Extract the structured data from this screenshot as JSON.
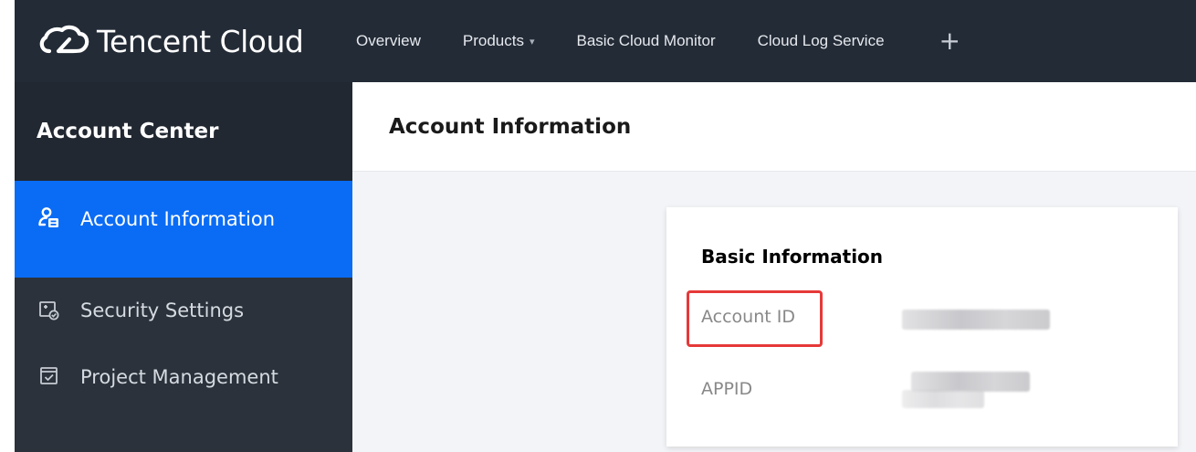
{
  "brand": {
    "name": "Tencent Cloud",
    "logo_icon": "tencent-cloud-logo-icon"
  },
  "nav": {
    "items": [
      {
        "label": "Overview"
      },
      {
        "label": "Products",
        "caret": "▾"
      },
      {
        "label": "Basic Cloud Monitor"
      },
      {
        "label": "Cloud Log Service"
      }
    ],
    "plus": "+"
  },
  "sidebar": {
    "title": "Account Center",
    "items": [
      {
        "label": "Account Information",
        "icon": "account-info-icon",
        "active": true
      },
      {
        "label": "Security Settings",
        "icon": "security-shield-icon",
        "active": false
      },
      {
        "label": "Project Management",
        "icon": "project-checkbox-icon",
        "active": false
      }
    ]
  },
  "main": {
    "page_title": "Account Information",
    "card": {
      "title": "Basic Information",
      "fields": [
        {
          "label": "Account ID",
          "highlighted": true
        },
        {
          "label": "APPID",
          "highlighted": false
        }
      ]
    }
  },
  "colors": {
    "topbar": "#232b36",
    "sidebar": "#2b323b",
    "sidebar_title": "#222831",
    "active": "#0a6cf5",
    "highlight": "#e63939"
  }
}
